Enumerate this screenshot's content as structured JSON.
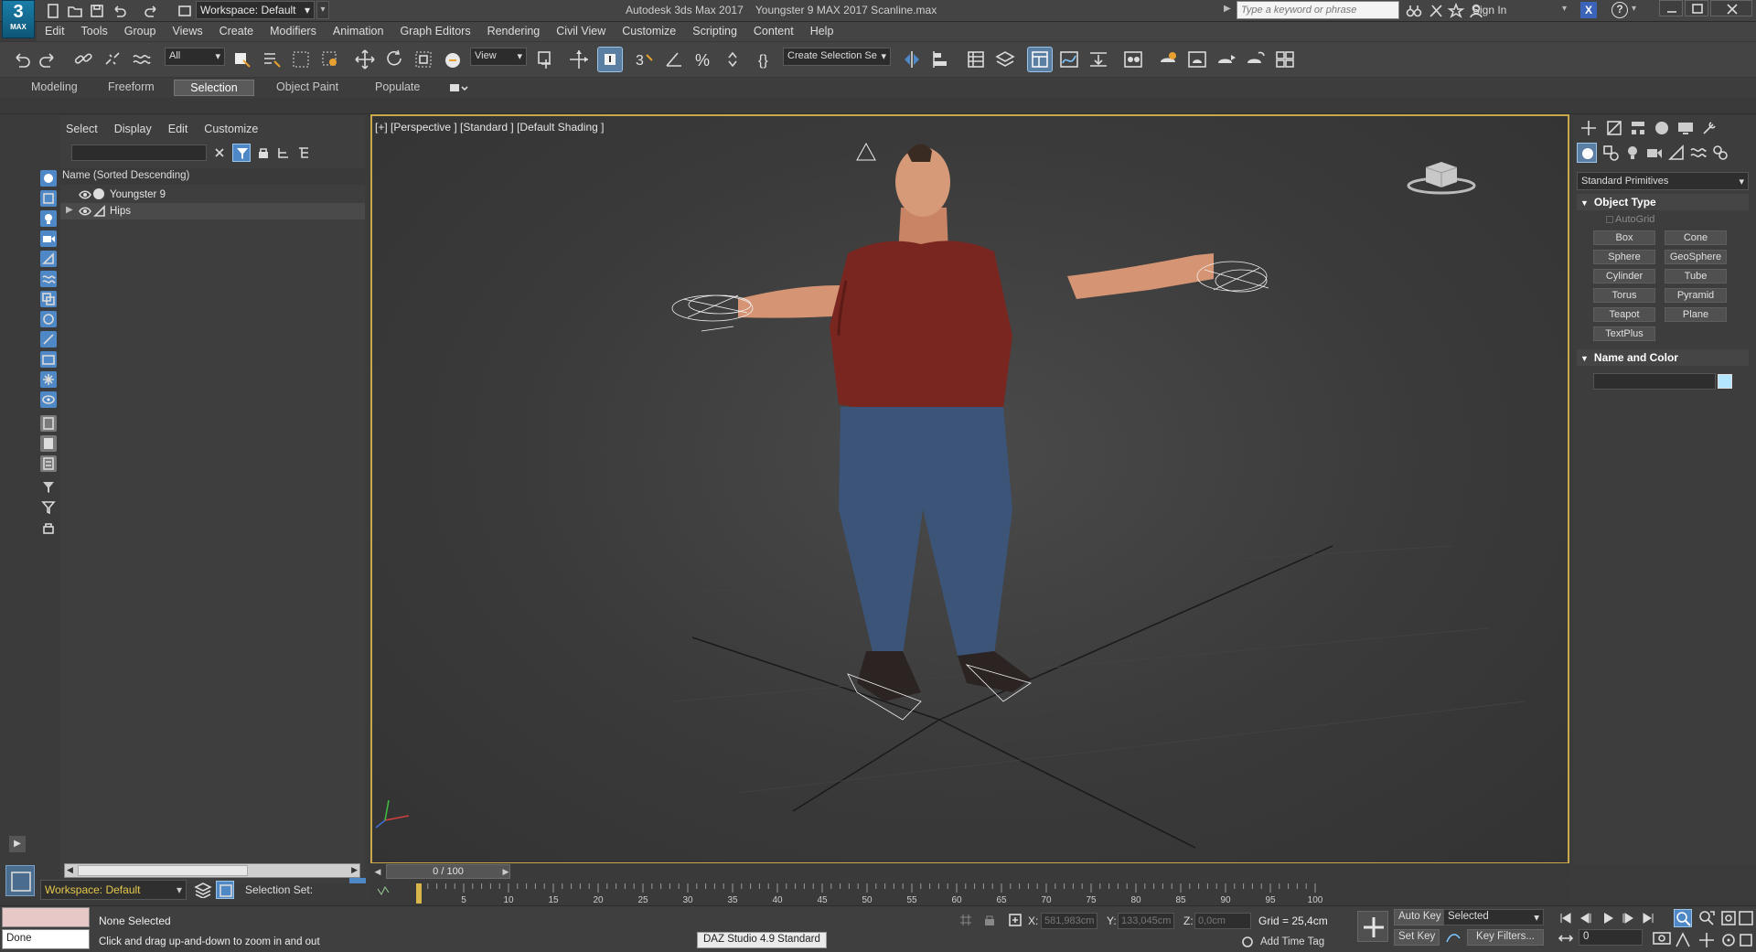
{
  "titlebar": {
    "logo_number": "3",
    "logo_text": "MAX",
    "workspace": "Workspace: Default",
    "app_name": "Autodesk 3ds Max 2017",
    "file_name": "Youngster 9 MAX 2017 Scanline.max",
    "search_placeholder": "Type a keyword or phrase",
    "sign_in": "Sign In"
  },
  "menubar": [
    "Edit",
    "Tools",
    "Group",
    "Views",
    "Create",
    "Modifiers",
    "Animation",
    "Graph Editors",
    "Rendering",
    "Civil View",
    "Customize",
    "Scripting",
    "Content",
    "Help"
  ],
  "toolbar": {
    "filter_dropdown": "All",
    "refcoord_dropdown": "View",
    "selection_set_dropdown": "Create Selection Se"
  },
  "ribbon": {
    "tabs": [
      "Modeling",
      "Freeform",
      "Selection",
      "Object Paint",
      "Populate"
    ],
    "selected_tab": "Selection"
  },
  "scene_explorer": {
    "menu": [
      "Select",
      "Display",
      "Edit",
      "Customize"
    ],
    "column_header": "Name (Sorted Descending)",
    "rows": [
      {
        "name": "Youngster 9"
      },
      {
        "name": "Hips"
      }
    ],
    "workspace": "Workspace: Default",
    "selection_set_label": "Selection Set:"
  },
  "viewport": {
    "label": "[+] [Perspective ] [Standard ] [Default Shading ]"
  },
  "command_panel": {
    "primitives_dropdown": "Standard Primitives",
    "object_type_title": "Object Type",
    "autogrid": "AutoGrid",
    "buttons": [
      "Box",
      "Cone",
      "Sphere",
      "GeoSphere",
      "Cylinder",
      "Tube",
      "Torus",
      "Pyramid",
      "Teapot",
      "Plane",
      "TextPlus"
    ],
    "name_color_title": "Name and Color",
    "swatch_color": "#b4e6ff"
  },
  "timeline": {
    "slider_text": "0 / 100",
    "ticks": [
      "5",
      "10",
      "15",
      "20",
      "25",
      "30",
      "35",
      "40",
      "45",
      "50",
      "55",
      "60",
      "65",
      "70",
      "75",
      "80",
      "85",
      "90",
      "95",
      "100"
    ]
  },
  "statusbar": {
    "selection_status": "None Selected",
    "prompt": "Click and drag up-and-down to zoom in and out",
    "done": "Done",
    "daz": "DAZ Studio 4.9 Standard",
    "x_label": "X:",
    "x_value": "581,983cm",
    "y_label": "Y:",
    "y_value": "133,045cm",
    "z_label": "Z:",
    "z_value": "0,0cm",
    "grid": "Grid = 25,4cm",
    "add_time_tag": "Add Time Tag",
    "auto_key": "Auto Key",
    "set_key": "Set Key",
    "key_mode_dropdown": "Selected",
    "key_filters": "Key Filters...",
    "current_frame": "0"
  },
  "colors": {
    "accent": "#5a7fa3",
    "viewport_border": "#c8a84a",
    "autokey_yellow": "#e5c84a"
  }
}
